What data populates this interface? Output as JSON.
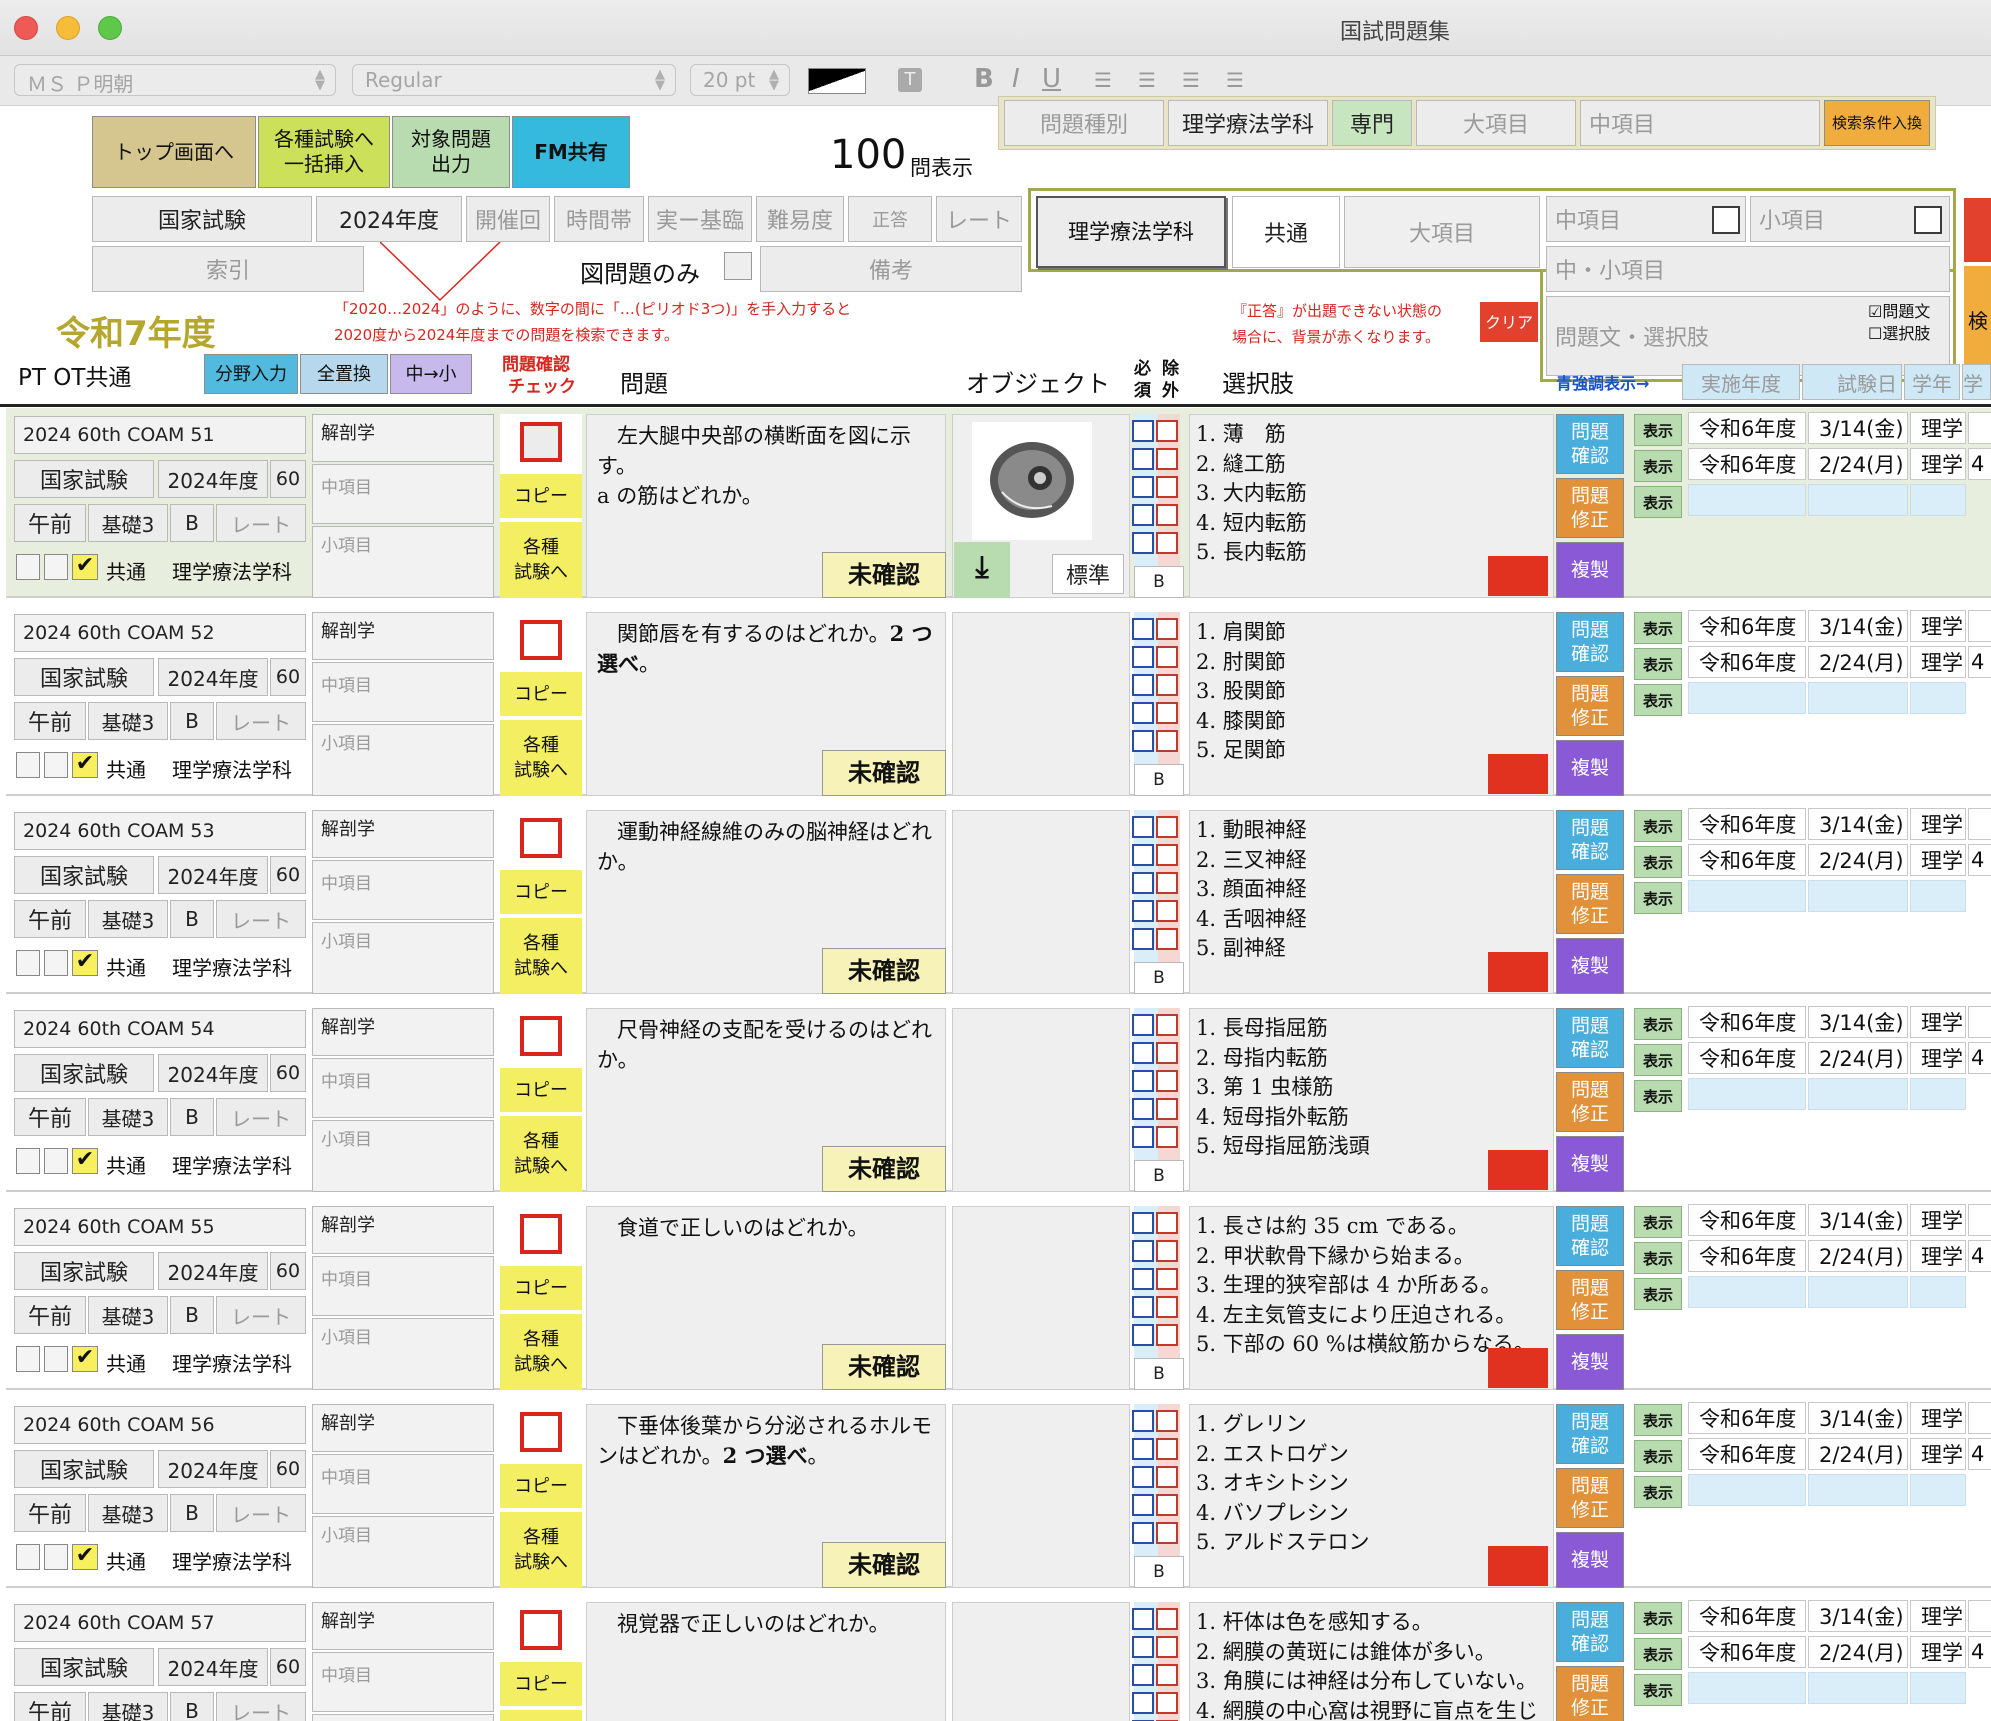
{
  "window": {
    "title": "国試問題集"
  },
  "format_toolbar": {
    "font": "ＭＳ Ｐ明朝",
    "style": "Regular",
    "size": "20 pt",
    "bold": "B",
    "italic": "I",
    "underline": "U"
  },
  "nav": {
    "top": "トップ画面へ",
    "bulk1": "各種試験へ",
    "bulk2": "一括挿入",
    "out1": "対象問題",
    "out2": "出力",
    "fm": "FM共有"
  },
  "count": {
    "value": "100",
    "unit": "問表示"
  },
  "search_top": {
    "type": "問題種別",
    "subject": "理学療法学科",
    "specialty": "専門",
    "major": "大項目",
    "middle": "中項目",
    "swap": "検索条件入換"
  },
  "filters": {
    "exam": "国家試験",
    "year": "2024年度",
    "session": "開催回",
    "time": "時間帯",
    "kind": "実ー基臨",
    "difficulty": "難易度",
    "answer": "正答",
    "rate": "レート",
    "index": "索引",
    "figure_only": "図問題のみ",
    "note": "備考"
  },
  "era": "令和7年度",
  "hint": {
    "line1": "「2020…2024」のように、数字の間に「…(ピリオド3つ)」を手入力すると",
    "line2": "2020度から2024年度までの問題を検索できます。"
  },
  "search_panel": {
    "subject": "理学療法学科",
    "common": "共通",
    "major": "大項目",
    "middle": "中項目",
    "small": "小項目",
    "mid_small": "中・小項目",
    "text": "問題文・選択肢",
    "opt_question": "☑問題文",
    "opt_choice": "☐選択肢",
    "warn1": "『正答』が出題できない状態の",
    "warn2": "場合に、背景が赤くなります。",
    "clear": "クリア",
    "kensaku": "検"
  },
  "column_header": {
    "ptot": "PT OT共通",
    "field_input": "分野入力",
    "replace_all": "全置換",
    "mid_small": "中→小",
    "check1": "問題確認",
    "check2": "チェック",
    "question": "問題",
    "object": "オブジェクト",
    "must1": "必",
    "must2": "須",
    "ex1": "除",
    "ex2": "外",
    "choices": "選択肢",
    "emphasis": "青強調表示→",
    "year": "実施年度",
    "exam_day": "試験日",
    "grade": "学年",
    "more": "学"
  },
  "row_labels": {
    "exam": "国家試験",
    "year": "2024年度",
    "num": "60",
    "am": "午前",
    "basic": "基礎3",
    "rank": "B",
    "rate": "レート",
    "common": "共通",
    "subject": "理学療法学科",
    "field": "解剖学",
    "middle": "中項目",
    "small": "小項目",
    "copy": "コピー",
    "to_exam1": "各種",
    "to_exam2": "試験へ",
    "unconfirmed": "未確認",
    "answer_rank": "B",
    "standard": "標準",
    "q_check1": "問題",
    "q_check2": "確認",
    "q_fix1": "問題",
    "q_fix2": "修正",
    "dup": "複製",
    "show": "表示",
    "r6": "令和6年度",
    "date1": "3/14(金)",
    "date2": "2/24(月)",
    "dept": "理学",
    "cut": "4"
  },
  "questions": [
    {
      "id": "2024 60th COAM 51",
      "text": "左大腿中央部の横断面を図に示す。<br>a の筋はどれか。",
      "choices": [
        "1. 薄　筋",
        "2. 縫工筋",
        "3. 大内転筋",
        "4. 短内転筋",
        "5. 長内転筋"
      ]
    },
    {
      "id": "2024 60th COAM 52",
      "text": "関節唇を有するのはどれか。<b>2 つ選べ</b>。",
      "choices": [
        "1. 肩関節",
        "2. 肘関節",
        "3. 股関節",
        "4. 膝関節",
        "5. 足関節"
      ]
    },
    {
      "id": "2024 60th COAM 53",
      "text": "運動神経線維のみの脳神経はどれか。",
      "choices": [
        "1. 動眼神経",
        "2. 三叉神経",
        "3. 顔面神経",
        "4. 舌咽神経",
        "5. 副神経"
      ]
    },
    {
      "id": "2024 60th COAM 54",
      "text": "尺骨神経の支配を受けるのはどれか。",
      "choices": [
        "1. 長母指屈筋",
        "2. 母指内転筋",
        "3. 第 1 虫様筋",
        "4. 短母指外転筋",
        "5. 短母指屈筋浅頭"
      ]
    },
    {
      "id": "2024 60th COAM 55",
      "text": "食道で正しいのはどれか。",
      "choices": [
        "1. 長さは約 35 cm である。",
        "2. 甲状軟骨下縁から始まる。",
        "3. 生理的狭窄部は 4 か所ある。",
        "4. 左主気管支により圧迫される。",
        "5. 下部の 60 %は横紋筋からなる。"
      ]
    },
    {
      "id": "2024 60th COAM 56",
      "text": "下垂体後葉から分泌されるホルモンはどれか。<b>2 つ選べ</b>。",
      "choices": [
        "1. グレリン",
        "2. エストロゲン",
        "3. オキシトシン",
        "4. バソプレシン",
        "5. アルドステロン"
      ]
    },
    {
      "id": "2024 60th COAM 57",
      "text": "視覚器で正しいのはどれか。",
      "choices": [
        "1. 杆体は色を感知する。",
        "2. 網膜の黄斑には錐体が多い。",
        "3. 角膜には神経は分布していない。",
        "4. 網膜の中心窩は視野に盲点を生じ"
      ]
    }
  ]
}
